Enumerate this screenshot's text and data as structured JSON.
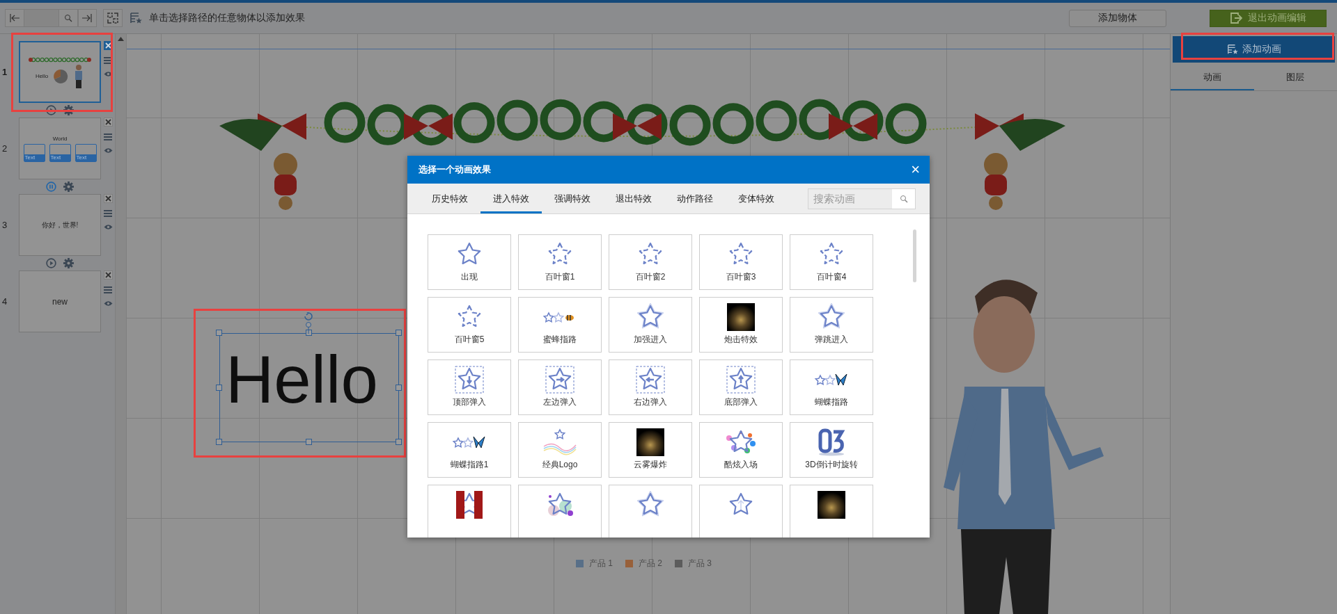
{
  "toolbar": {
    "hint": "单击选择路径的任意物体以添加效果",
    "buttons": [
      {
        "label": "添加物体",
        "kind": "plain"
      },
      {
        "label": "退出动画编辑",
        "kind": "exit"
      }
    ]
  },
  "slides": [
    {
      "number": "1",
      "kind": "scene",
      "title": "Hello",
      "selected": true,
      "highlighted": true,
      "playing": false
    },
    {
      "number": "2",
      "kind": "cards",
      "title": "World",
      "cards": [
        "Text",
        "Text",
        "Text"
      ],
      "selected": false,
      "highlighted": false,
      "playing": true
    },
    {
      "number": "3",
      "kind": "text",
      "title": "你好，世界!",
      "selected": false,
      "highlighted": false,
      "playing": false
    },
    {
      "number": "4",
      "kind": "text",
      "title": "new",
      "selected": false,
      "highlighted": false
    }
  ],
  "canvas": {
    "text_box": {
      "text": "Hello",
      "selected": true,
      "highlighted": true
    },
    "legend": [
      {
        "label": "产品 1",
        "color": "#586f88"
      },
      {
        "label": "产品 2",
        "color": "#98603a"
      },
      {
        "label": "产品 3",
        "color": "#5c5c5c"
      }
    ]
  },
  "right_panel": {
    "add_button": {
      "label": "添加动画",
      "highlighted": true
    },
    "tabs": [
      {
        "label": "动画",
        "selected": true
      },
      {
        "label": "图层",
        "selected": false
      }
    ]
  },
  "dialog": {
    "title": "选择一个动画效果",
    "close": "×",
    "tabs": [
      {
        "label": "历史特效",
        "selected": false
      },
      {
        "label": "进入特效",
        "selected": true
      },
      {
        "label": "强调特效",
        "selected": false
      },
      {
        "label": "退出特效",
        "selected": false
      },
      {
        "label": "动作路径",
        "selected": false
      },
      {
        "label": "变体特效",
        "selected": false
      }
    ],
    "search": {
      "placeholder": "搜索动画"
    },
    "effects": [
      {
        "label": "出现",
        "kind": "star"
      },
      {
        "label": "百叶窗1",
        "kind": "dashed-star"
      },
      {
        "label": "百叶窗2",
        "kind": "dashed-star"
      },
      {
        "label": "百叶窗3",
        "kind": "dashed-star"
      },
      {
        "label": "百叶窗4",
        "kind": "dashed-star"
      },
      {
        "label": "百叶窗5",
        "kind": "dashed-star"
      },
      {
        "label": "蜜蜂指路",
        "kind": "bee-trail"
      },
      {
        "label": "加强进入",
        "kind": "double-star"
      },
      {
        "label": "炮击特效",
        "kind": "dark-image"
      },
      {
        "label": "弹跳进入",
        "kind": "double-star"
      },
      {
        "label": "顶部弹入",
        "kind": "drop-down"
      },
      {
        "label": "左边弹入",
        "kind": "drop-right"
      },
      {
        "label": "右边弹入",
        "kind": "drop-left"
      },
      {
        "label": "底部弹入",
        "kind": "drop-up"
      },
      {
        "label": "蝴蝶指路",
        "kind": "butterfly-trail"
      },
      {
        "label": "蝴蝶指路1",
        "kind": "butterfly-trail"
      },
      {
        "label": "经典Logo",
        "kind": "logo"
      },
      {
        "label": "云雾爆炸",
        "kind": "dark-image"
      },
      {
        "label": "酷炫入场",
        "kind": "color-dots"
      },
      {
        "label": "3D倒计时旋转",
        "kind": "number-3d"
      },
      {
        "kind": "curtain"
      },
      {
        "kind": "bubbles"
      },
      {
        "kind": "double-star"
      },
      {
        "kind": "arrow-star"
      },
      {
        "kind": "dark-image"
      }
    ]
  }
}
